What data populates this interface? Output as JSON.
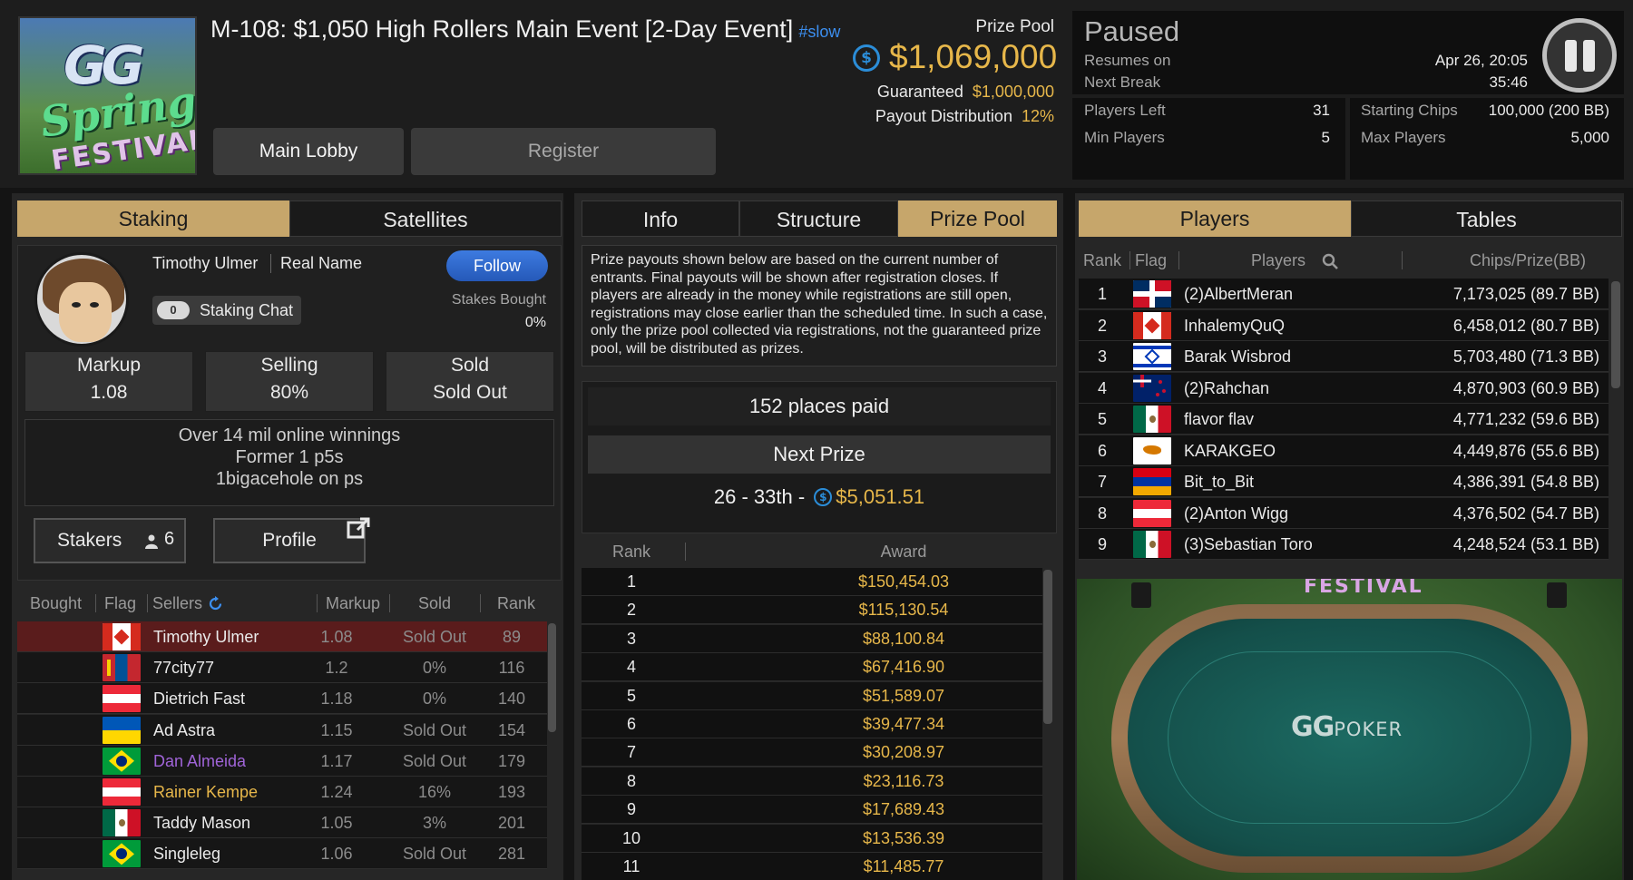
{
  "header": {
    "title": "M-108: $1,050 High Rollers Main Event [2-Day Event]",
    "speed_tag": "#slow",
    "main_lobby": "Main Lobby",
    "register": "Register",
    "logo": "GG Spring FESTIVAL"
  },
  "prize": {
    "label": "Prize Pool",
    "amount": "$1,069,000",
    "guaranteed_label": "Guaranteed",
    "guaranteed_value": "$1,000,000",
    "payout_label": "Payout Distribution",
    "payout_value": "12%"
  },
  "status": {
    "state": "Paused",
    "resumes_label_1": "Resumes on",
    "resumes_label_2": "Next Break",
    "resume_date": "Apr 26, 20:05",
    "resume_countdown": "35:46",
    "players_left_label": "Players Left",
    "players_left": "31",
    "min_players_label": "Min Players",
    "min_players": "5",
    "starting_chips_label": "Starting Chips",
    "starting_chips": "100,000 (200 BB)",
    "max_players_label": "Max Players",
    "max_players": "5,000"
  },
  "left": {
    "tabs": [
      "Staking",
      "Satellites"
    ],
    "staker_name": "Timothy Ulmer",
    "real_name": "Real Name",
    "follow": "Follow",
    "chat_count": "0",
    "staking_chat": "Staking Chat",
    "stakes_bought_label": "Stakes Bought",
    "stakes_bought_value": "0%",
    "markup_label": "Markup",
    "markup_value": "1.08",
    "selling_label": "Selling",
    "selling_value": "80%",
    "sold_label": "Sold",
    "sold_value": "Sold Out",
    "bio": [
      "Over 14 mil online winnings",
      "Former 1 p5s",
      "1bigacehole on ps"
    ],
    "stakers_label": "Stakers",
    "stakers_count": "6",
    "profile_label": "Profile",
    "columns": [
      "Bought",
      "Flag",
      "Sellers",
      "Markup",
      "Sold",
      "Rank"
    ],
    "sellers": [
      {
        "name": "Timothy Ulmer",
        "markup": "1.08",
        "sold": "Sold Out",
        "rank": "89",
        "flag": "ca",
        "color": "#eaeaea"
      },
      {
        "name": "77city77",
        "markup": "1.2",
        "sold": "0%",
        "rank": "116",
        "flag": "mn",
        "color": "#eaeaea"
      },
      {
        "name": "Dietrich Fast",
        "markup": "1.18",
        "sold": "0%",
        "rank": "140",
        "flag": "at",
        "color": "#eaeaea"
      },
      {
        "name": "Ad Astra",
        "markup": "1.15",
        "sold": "Sold Out",
        "rank": "154",
        "flag": "ua",
        "color": "#eaeaea"
      },
      {
        "name": "Dan Almeida",
        "markup": "1.17",
        "sold": "Sold Out",
        "rank": "179",
        "flag": "br",
        "color": "#a064d8"
      },
      {
        "name": "Rainer Kempe",
        "markup": "1.24",
        "sold": "16%",
        "rank": "193",
        "flag": "at",
        "color": "#e7b74a"
      },
      {
        "name": "Taddy Mason",
        "markup": "1.05",
        "sold": "3%",
        "rank": "201",
        "flag": "mx",
        "color": "#eaeaea"
      },
      {
        "name": "Singleleg",
        "markup": "1.06",
        "sold": "Sold Out",
        "rank": "281",
        "flag": "br",
        "color": "#eaeaea"
      }
    ]
  },
  "middle": {
    "tabs": [
      "Info",
      "Structure",
      "Prize Pool"
    ],
    "notice": "Prize payouts shown below are based on the current number of entrants. Final payouts will be shown after registration closes. If players are already in the money while registrations are still open, registrations may close earlier than the scheduled time. In such a case, only the prize pool collected via registrations, not the guaranteed prize pool, will be distributed as prizes.",
    "places_paid": "152 places paid",
    "next_prize_label": "Next Prize",
    "next_prize_range": "26 - 33th",
    "next_prize_amount": "$5,051.51",
    "columns": [
      "Rank",
      "Award"
    ],
    "awards": [
      {
        "rank": "1",
        "award": "$150,454.03"
      },
      {
        "rank": "2",
        "award": "$115,130.54"
      },
      {
        "rank": "3",
        "award": "$88,100.84"
      },
      {
        "rank": "4",
        "award": "$67,416.90"
      },
      {
        "rank": "5",
        "award": "$51,589.07"
      },
      {
        "rank": "6",
        "award": "$39,477.34"
      },
      {
        "rank": "7",
        "award": "$30,208.97"
      },
      {
        "rank": "8",
        "award": "$23,116.73"
      },
      {
        "rank": "9",
        "award": "$17,689.43"
      },
      {
        "rank": "10",
        "award": "$13,536.39"
      },
      {
        "rank": "11",
        "award": "$11,485.77"
      }
    ]
  },
  "right": {
    "tabs": [
      "Players",
      "Tables"
    ],
    "columns": [
      "Rank",
      "Flag",
      "Players",
      "Chips/Prize(BB)"
    ],
    "players": [
      {
        "rank": "1",
        "name": "(2)AlbertMeran",
        "chips": "7,173,025 (89.7 BB)",
        "flag": "do"
      },
      {
        "rank": "2",
        "name": "InhalemyQuQ",
        "chips": "6,458,012 (80.7 BB)",
        "flag": "ca"
      },
      {
        "rank": "3",
        "name": "Barak Wisbrod",
        "chips": "5,703,480 (71.3 BB)",
        "flag": "il"
      },
      {
        "rank": "4",
        "name": "(2)Rahchan",
        "chips": "4,870,903 (60.9 BB)",
        "flag": "nz"
      },
      {
        "rank": "5",
        "name": "flavor flav",
        "chips": "4,771,232 (59.6 BB)",
        "flag": "mx"
      },
      {
        "rank": "6",
        "name": "KARAKGEO",
        "chips": "4,449,876 (55.6 BB)",
        "flag": "cy"
      },
      {
        "rank": "7",
        "name": "Bit_to_Bit",
        "chips": "4,386,391 (54.8 BB)",
        "flag": "am"
      },
      {
        "rank": "8",
        "name": "(2)Anton Wigg",
        "chips": "4,376,502 (54.7 BB)",
        "flag": "at"
      },
      {
        "rank": "9",
        "name": "(3)Sebastian Toro",
        "chips": "4,248,524 (53.1 BB)",
        "flag": "mx"
      }
    ],
    "table_logo": "GG",
    "table_logo_suffix": "POKER"
  },
  "colors": {
    "accent_gold": "#c6a66b",
    "money": "#e7b74a",
    "follow_blue": "#2f6bd0",
    "selected_row": "#5a1c1c"
  }
}
